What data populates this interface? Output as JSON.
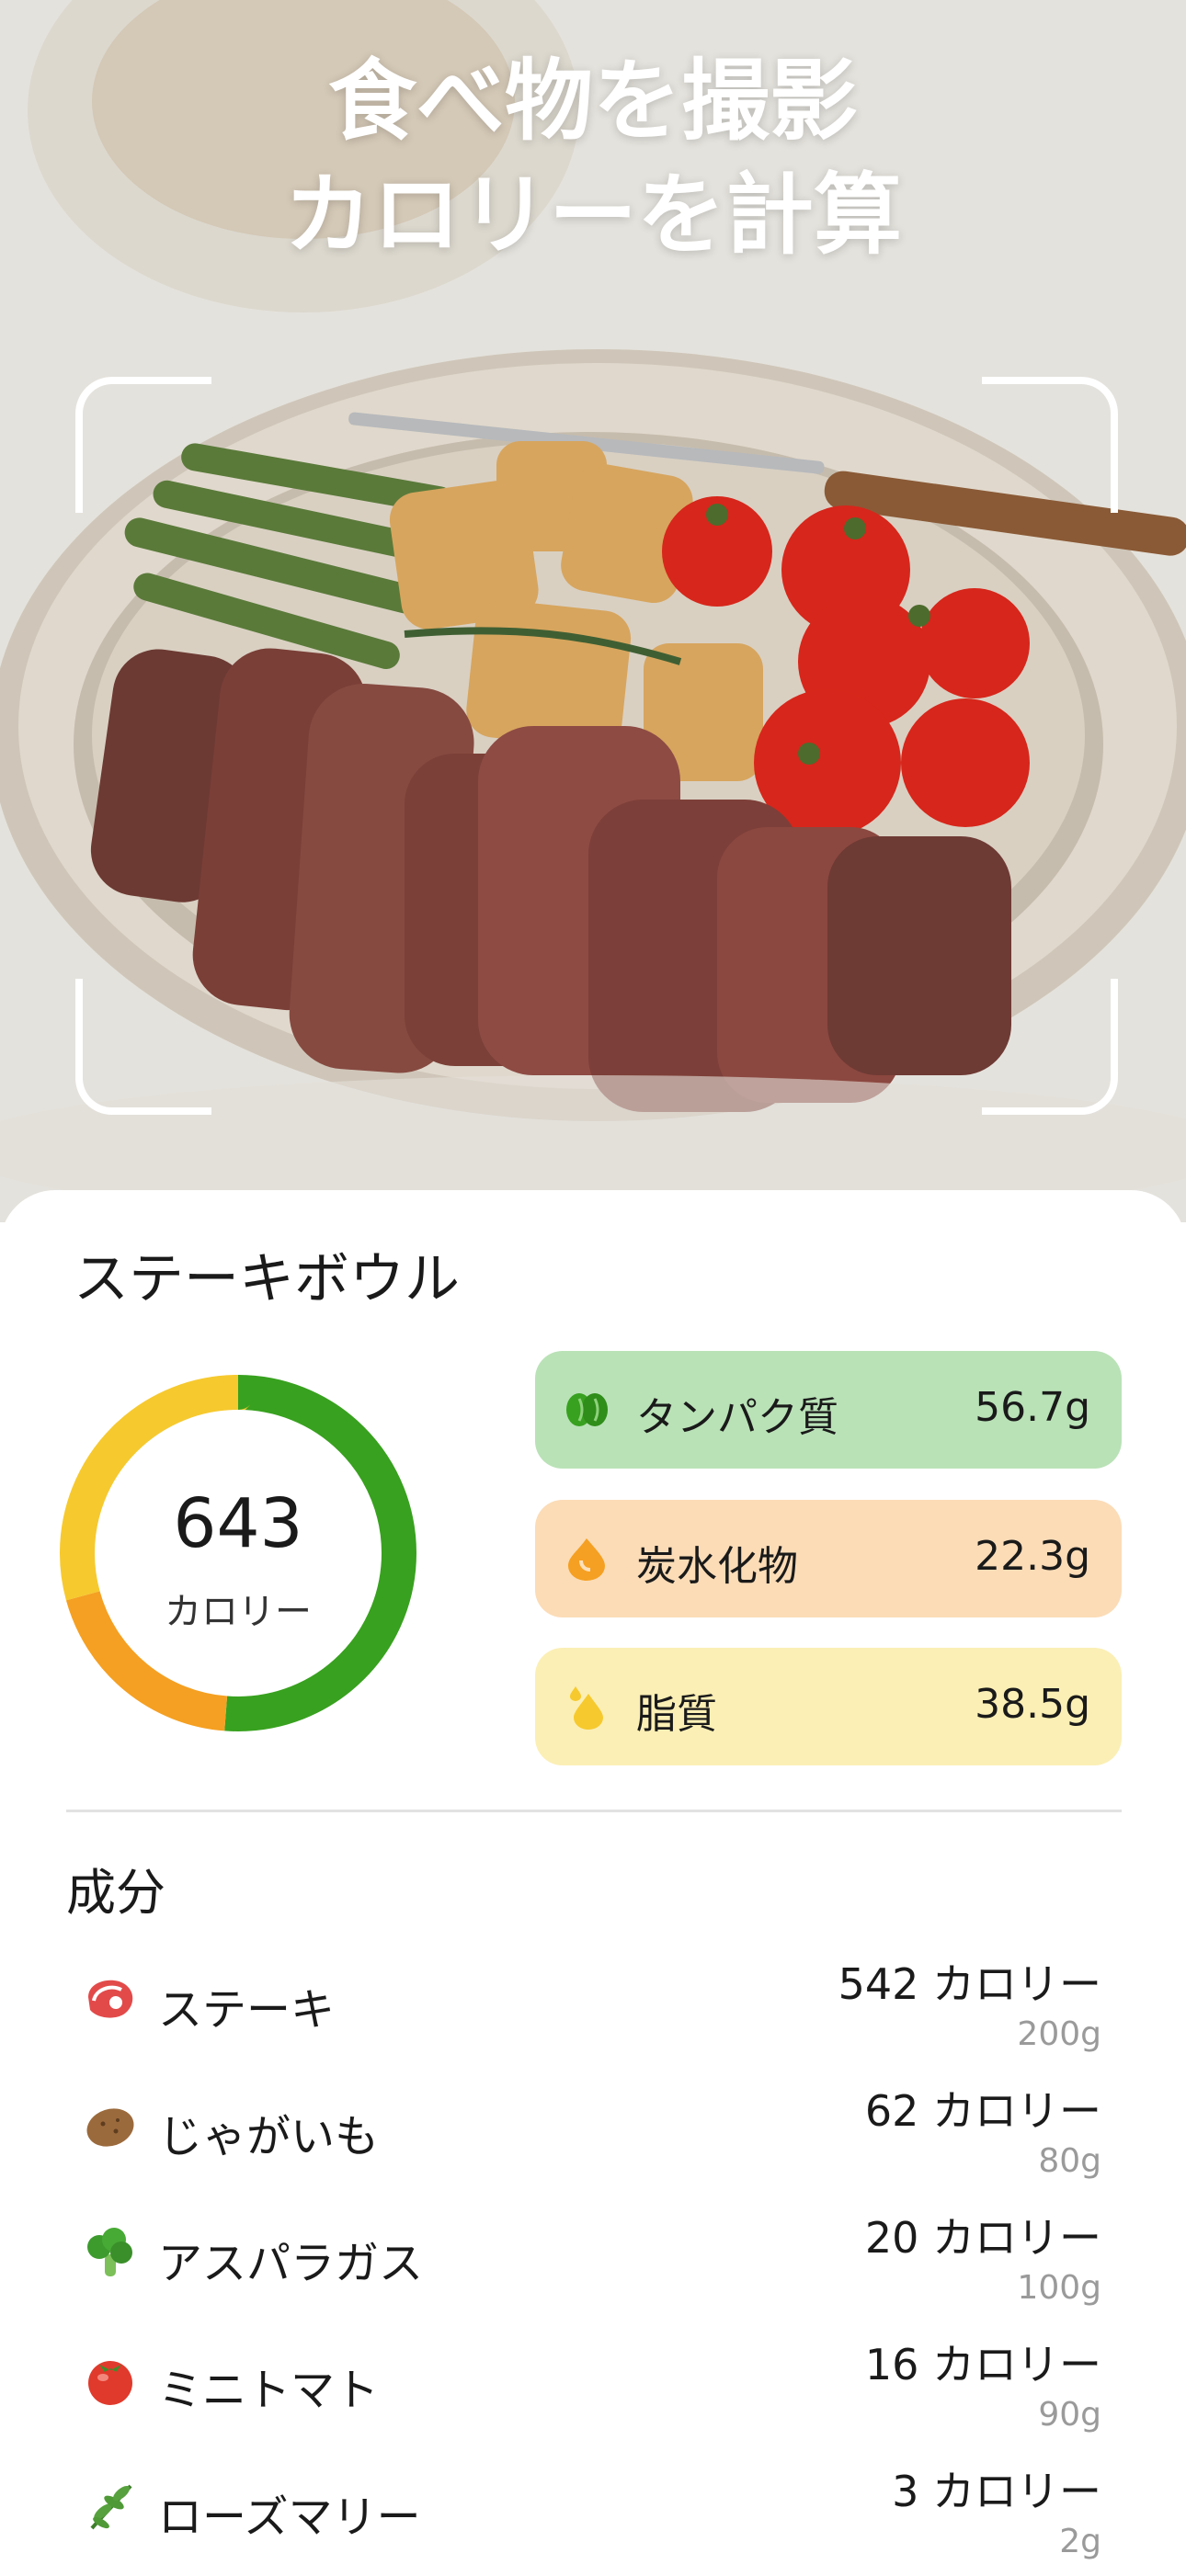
{
  "hero": {
    "headline_line1": "食べ物を撮影",
    "headline_line2": "カロリーを計算"
  },
  "result": {
    "dish_name": "ステーキボウル",
    "calories": "643",
    "calories_unit": "カロリー",
    "ring": {
      "segments": [
        {
          "name": "protein",
          "color": "#38a11f",
          "fraction": 0.512
        },
        {
          "name": "carbs",
          "color": "#f5a022",
          "fraction": 0.195
        },
        {
          "name": "fat",
          "color": "#f6c92e",
          "fraction": 0.293
        }
      ]
    },
    "macros": [
      {
        "label": "タンパク質",
        "value": "56.7g",
        "icon": "bean-icon",
        "color": "#38a11f"
      },
      {
        "label": "炭水化物",
        "value": "22.3g",
        "icon": "flame-drop-icon",
        "color": "#f5a022"
      },
      {
        "label": "脂質",
        "value": "38.5g",
        "icon": "oil-drop-icon",
        "color": "#f6c92e"
      }
    ]
  },
  "ingredients": {
    "title": "成分",
    "items": [
      {
        "name": "ステーキ",
        "calories": "542 カロリー",
        "weight": "200g",
        "icon": "meat-icon"
      },
      {
        "name": "じゃがいも",
        "calories": "62 カロリー",
        "weight": "80g",
        "icon": "potato-icon"
      },
      {
        "name": "アスパラガス",
        "calories": "20 カロリー",
        "weight": "100g",
        "icon": "broccoli-icon"
      },
      {
        "name": "ミニトマト",
        "calories": "16 カロリー",
        "weight": "90g",
        "icon": "tomato-icon"
      },
      {
        "name": "ローズマリー",
        "calories": "3 カロリー",
        "weight": "2g",
        "icon": "herb-icon"
      }
    ]
  }
}
